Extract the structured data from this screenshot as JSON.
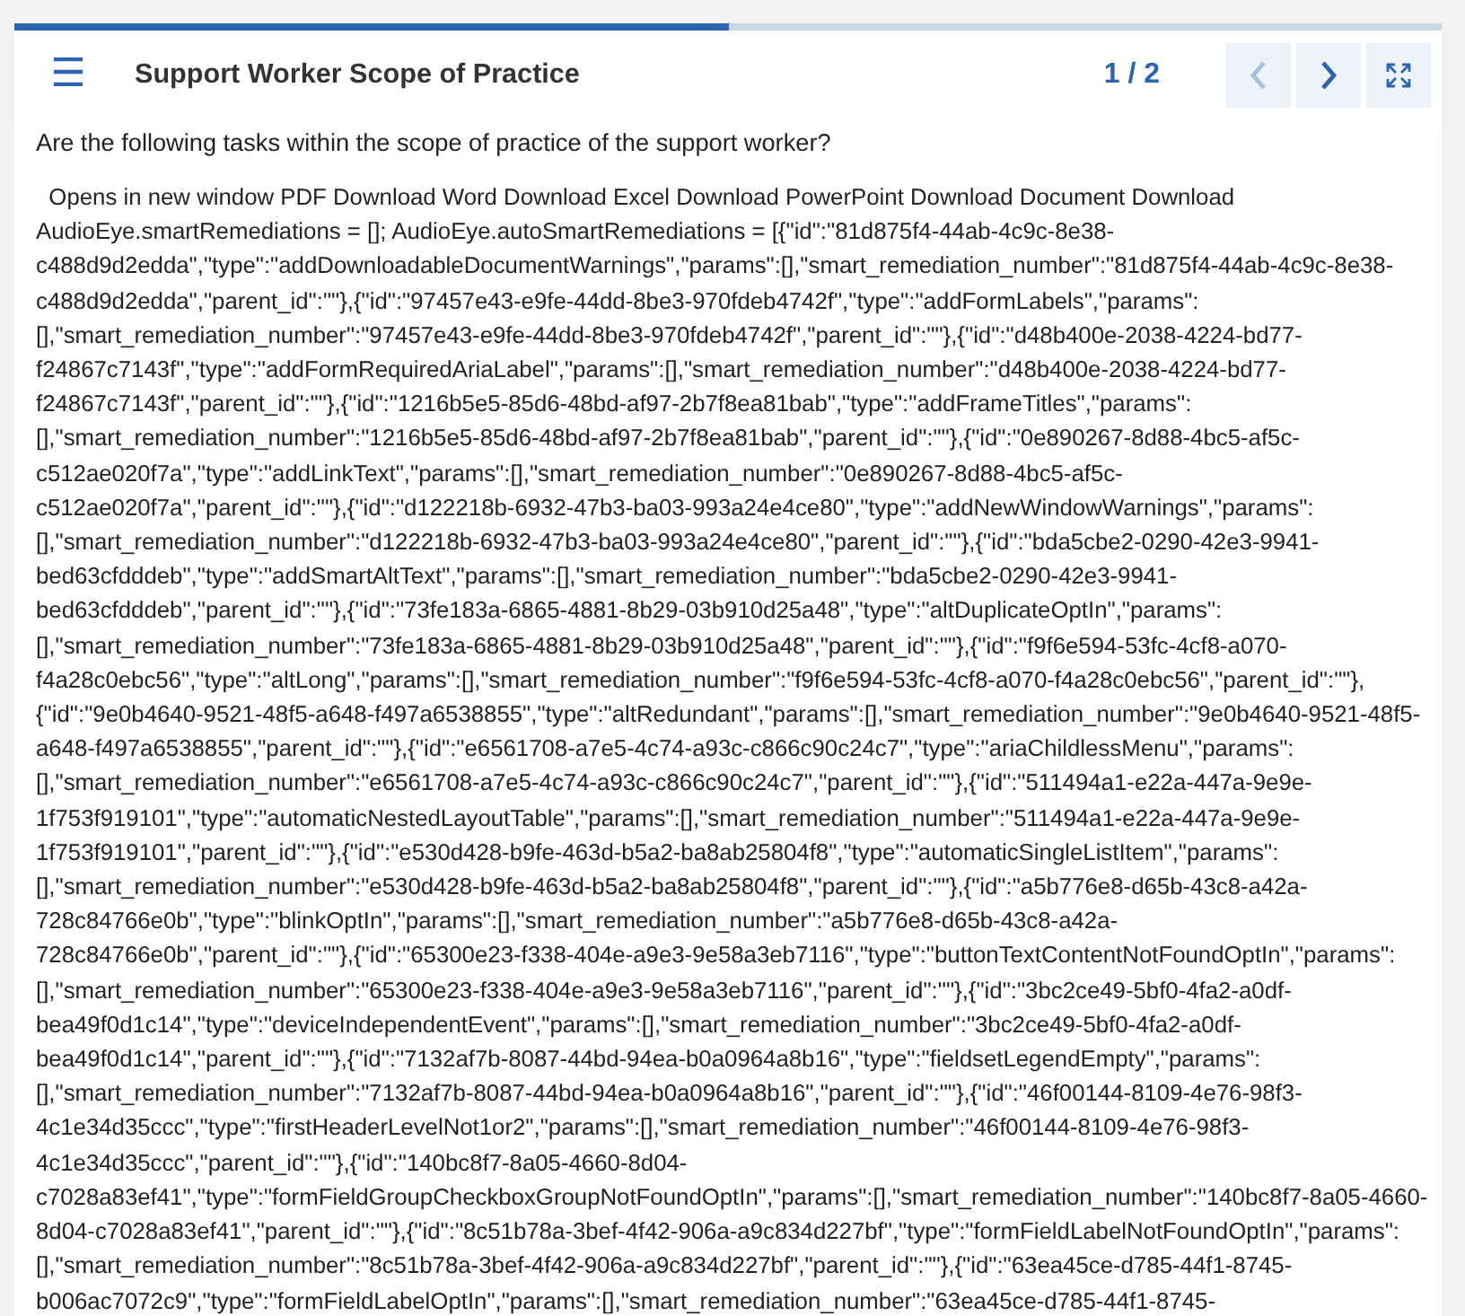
{
  "progress": {
    "level": 0.5
  },
  "header": {
    "menu_icon": "☰",
    "title": "Support Worker Scope of Practice",
    "page_counter": "1 / 2",
    "nav_buttons": [
      {
        "kind": "previous",
        "disabled": true
      },
      {
        "kind": "next",
        "disabled": false
      },
      {
        "kind": "expand",
        "disabled": false
      }
    ]
  },
  "question": "Are the following tasks within the scope of practice of the support worker?",
  "body_lines": [
    "  Opens in new window PDF Download Word Download Excel Download PowerPoint Download Document Download",
    "AudioEye.smartRemediations = []; AudioEye.autoSmartRemediations = [{\"id\":\"81d875f4-44ab-4c9c-8e38-",
    "c488d9d2edda\",\"type\":\"addDownloadableDocumentWarnings\",\"params\":[],\"smart_remediation_number\":\"81d875f4-44ab-4c9c-8e38-",
    "c488d9d2edda\",\"parent_id\":\"\"},{\"id\":\"97457e43-e9fe-44dd-8be3-970fdeb4742f\",\"type\":\"addFormLabels\",\"params\":",
    "[],\"smart_remediation_number\":\"97457e43-e9fe-44dd-8be3-970fdeb4742f\",\"parent_id\":\"\"},{\"id\":\"d48b400e-2038-4224-bd77-",
    "f24867c7143f\",\"type\":\"addFormRequiredAriaLabel\",\"params\":[],\"smart_remediation_number\":\"d48b400e-2038-4224-bd77-",
    "f24867c7143f\",\"parent_id\":\"\"},{\"id\":\"1216b5e5-85d6-48bd-af97-2b7f8ea81bab\",\"type\":\"addFrameTitles\",\"params\":",
    "[],\"smart_remediation_number\":\"1216b5e5-85d6-48bd-af97-2b7f8ea81bab\",\"parent_id\":\"\"},{\"id\":\"0e890267-8d88-4bc5-af5c-",
    "c512ae020f7a\",\"type\":\"addLinkText\",\"params\":[],\"smart_remediation_number\":\"0e890267-8d88-4bc5-af5c-",
    "c512ae020f7a\",\"parent_id\":\"\"},{\"id\":\"d122218b-6932-47b3-ba03-993a24e4ce80\",\"type\":\"addNewWindowWarnings\",\"params\":",
    "[],\"smart_remediation_number\":\"d122218b-6932-47b3-ba03-993a24e4ce80\",\"parent_id\":\"\"},{\"id\":\"bda5cbe2-0290-42e3-9941-",
    "bed63cfdddeb\",\"type\":\"addSmartAltText\",\"params\":[],\"smart_remediation_number\":\"bda5cbe2-0290-42e3-9941-",
    "bed63cfdddeb\",\"parent_id\":\"\"},{\"id\":\"73fe183a-6865-4881-8b29-03b910d25a48\",\"type\":\"altDuplicateOptIn\",\"params\":",
    "[],\"smart_remediation_number\":\"73fe183a-6865-4881-8b29-03b910d25a48\",\"parent_id\":\"\"},{\"id\":\"f9f6e594-53fc-4cf8-a070-",
    "f4a28c0ebc56\",\"type\":\"altLong\",\"params\":[],\"smart_remediation_number\":\"f9f6e594-53fc-4cf8-a070-f4a28c0ebc56\",\"parent_id\":\"\"},",
    "{\"id\":\"9e0b4640-9521-48f5-a648-f497a6538855\",\"type\":\"altRedundant\",\"params\":[],\"smart_remediation_number\":\"9e0b4640-9521-48f5-",
    "a648-f497a6538855\",\"parent_id\":\"\"},{\"id\":\"e6561708-a7e5-4c74-a93c-c866c90c24c7\",\"type\":\"ariaChildlessMenu\",\"params\":",
    "[],\"smart_remediation_number\":\"e6561708-a7e5-4c74-a93c-c866c90c24c7\",\"parent_id\":\"\"},{\"id\":\"511494a1-e22a-447a-9e9e-",
    "1f753f919101\",\"type\":\"automaticNestedLayoutTable\",\"params\":[],\"smart_remediation_number\":\"511494a1-e22a-447a-9e9e-",
    "1f753f919101\",\"parent_id\":\"\"},{\"id\":\"e530d428-b9fe-463d-b5a2-ba8ab25804f8\",\"type\":\"automaticSingleListItem\",\"params\":",
    "[],\"smart_remediation_number\":\"e530d428-b9fe-463d-b5a2-ba8ab25804f8\",\"parent_id\":\"\"},{\"id\":\"a5b776e8-d65b-43c8-a42a-",
    "728c84766e0b\",\"type\":\"blinkOptIn\",\"params\":[],\"smart_remediation_number\":\"a5b776e8-d65b-43c8-a42a-",
    "728c84766e0b\",\"parent_id\":\"\"},{\"id\":\"65300e23-f338-404e-a9e3-9e58a3eb7116\",\"type\":\"buttonTextContentNotFoundOptIn\",\"params\":",
    "[],\"smart_remediation_number\":\"65300e23-f338-404e-a9e3-9e58a3eb7116\",\"parent_id\":\"\"},{\"id\":\"3bc2ce49-5bf0-4fa2-a0df-",
    "bea49f0d1c14\",\"type\":\"deviceIndependentEvent\",\"params\":[],\"smart_remediation_number\":\"3bc2ce49-5bf0-4fa2-a0df-",
    "bea49f0d1c14\",\"parent_id\":\"\"},{\"id\":\"7132af7b-8087-44bd-94ea-b0a0964a8b16\",\"type\":\"fieldsetLegendEmpty\",\"params\":",
    "[],\"smart_remediation_number\":\"7132af7b-8087-44bd-94ea-b0a0964a8b16\",\"parent_id\":\"\"},{\"id\":\"46f00144-8109-4e76-98f3-",
    "4c1e34d35ccc\",\"type\":\"firstHeaderLevelNot1or2\",\"params\":[],\"smart_remediation_number\":\"46f00144-8109-4e76-98f3-",
    "4c1e34d35ccc\",\"parent_id\":\"\"},{\"id\":\"140bc8f7-8a05-4660-8d04-",
    "c7028a83ef41\",\"type\":\"formFieldGroupCheckboxGroupNotFoundOptIn\",\"params\":[],\"smart_remediation_number\":\"140bc8f7-8a05-4660-",
    "8d04-c7028a83ef41\",\"parent_id\":\"\"},{\"id\":\"8c51b78a-3bef-4f42-906a-a9c834d227bf\",\"type\":\"formFieldLabelNotFoundOptIn\",\"params\":",
    "[],\"smart_remediation_number\":\"8c51b78a-3bef-4f42-906a-a9c834d227bf\",\"parent_id\":\"\"},{\"id\":\"63ea45ce-d785-44f1-8745-",
    "b006ac7072c9\",\"type\":\"formFieldLabelOptIn\",\"params\":[],\"smart_remediation_number\":\"63ea45ce-d785-44f1-8745-"
  ]
}
